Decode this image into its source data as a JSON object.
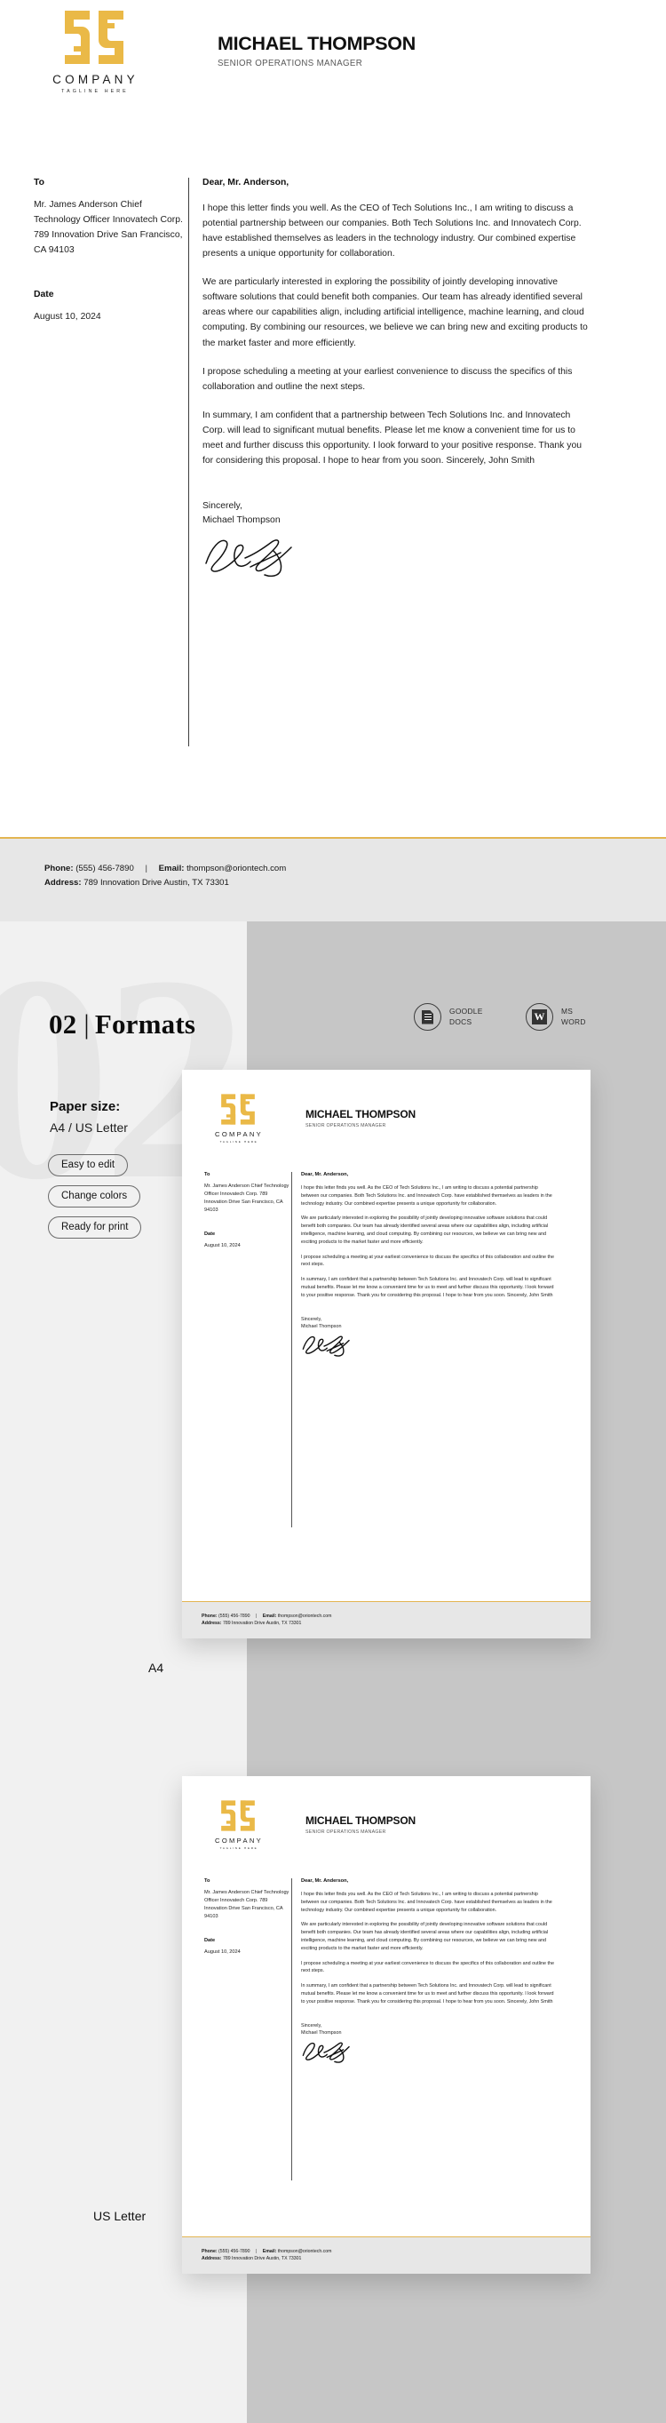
{
  "brand": {
    "logo_icon": "company-monogram-icon",
    "company_name": "COMPANY",
    "tagline": "TAGLINE HERE",
    "accent_color": "#e3b552",
    "logo_color": "#eab947"
  },
  "letterhead": {
    "person_name": "MICHAEL THOMPSON",
    "person_title": "SENIOR OPERATIONS MANAGER",
    "to_label": "To",
    "to_address": "Mr. James Anderson Chief Technology Officer Innovatech Corp. 789 Innovation Drive San Francisco, CA 94103",
    "date_label": "Date",
    "date_value": "August 10, 2024",
    "salutation": "Dear, Mr. Anderson,",
    "paragraphs": [
      "I hope this letter finds you well. As the CEO of Tech Solutions Inc., I am writing to discuss a potential partnership between our companies. Both Tech Solutions Inc. and Innovatech Corp. have established themselves as leaders in the technology industry. Our combined expertise presents a unique opportunity for collaboration.",
      "We are particularly interested in exploring the possibility of jointly developing innovative software solutions that could benefit both companies. Our team has already identified several areas where our capabilities align, including artificial intelligence, machine learning, and cloud computing. By combining our resources, we believe we can bring new and exciting products to the market faster and more efficiently.",
      "I propose scheduling a meeting at your earliest convenience to discuss the specifics of this collaboration and outline the next steps.",
      "In summary, I am confident that a partnership between Tech Solutions Inc. and Innovatech Corp. will lead to significant mutual benefits. Please let me know a convenient time for us to meet and further discuss this opportunity. I look forward to your positive response. Thank you for considering this proposal. I hope to hear from you soon. Sincerely, John Smith"
    ],
    "closing_line1": "Sincerely,",
    "closing_line2": "Michael Thompson",
    "signature_icon": "handwritten-signature-icon",
    "footer": {
      "phone_label": "Phone:",
      "phone_value": "(555) 456-7890",
      "separator": "|",
      "email_label": "Email:",
      "email_value": "thompson@oriontech.com",
      "address_label": "Address:",
      "address_value": "789 Innovation Drive Austin, TX 73301"
    }
  },
  "formats_section": {
    "watermark": "02",
    "number": "02",
    "divider": "|",
    "title": "Formats",
    "paper_size_label": "Paper size:",
    "paper_size_value": "A4 / US Letter",
    "pills": [
      "Easy to edit",
      "Change colors",
      "Ready for print"
    ],
    "badges": [
      {
        "icon": "google-docs-icon",
        "line1": "GOODLE",
        "line2": "DOCS"
      },
      {
        "icon": "ms-word-icon",
        "line1": "MS",
        "line2": "WORD"
      }
    ],
    "previews": [
      {
        "caption": "A4"
      },
      {
        "caption": "US Letter"
      }
    ]
  }
}
